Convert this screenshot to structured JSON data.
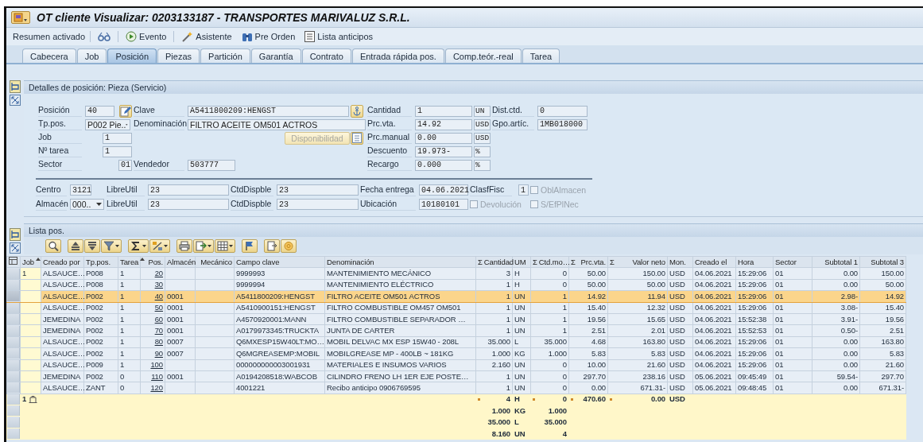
{
  "window": {
    "title": "OT cliente Visualizar: 0203133187 - TRANSPORTES MARIVALUZ S.R.L."
  },
  "toolbar": {
    "summary": "Resumen activado",
    "buttons": [
      {
        "kind": "glasses"
      },
      {
        "kind": "event",
        "label": "Evento"
      },
      {
        "kind": "wizard",
        "label": "Asistente"
      },
      {
        "kind": "binoculars",
        "label": "Pre Orden"
      },
      {
        "kind": "list",
        "label": "Lista anticipos"
      }
    ]
  },
  "tabs": [
    {
      "label": "Cabecera",
      "selected": false
    },
    {
      "label": "Job",
      "selected": false
    },
    {
      "label": "Posición",
      "selected": true
    },
    {
      "label": "Piezas",
      "selected": false
    },
    {
      "label": "Partición",
      "selected": false
    },
    {
      "label": "Garantía",
      "selected": false
    },
    {
      "label": "Contrato",
      "selected": false
    },
    {
      "label": "Entrada rápida pos.",
      "selected": false
    },
    {
      "label": "Comp.teór.-real",
      "selected": false
    },
    {
      "label": "Tarea",
      "selected": false
    }
  ],
  "details": {
    "title": "Detalles de posición: Pieza (Servicio)",
    "posicion": {
      "label": "Posición",
      "value": "40"
    },
    "tp_pos": {
      "label": "Tp.pos.",
      "value": "P002 Pie.."
    },
    "job": {
      "label": "Job",
      "value": "1"
    },
    "n_tarea": {
      "label": "Nº tarea",
      "value": "1"
    },
    "sector": {
      "label": "Sector",
      "value": "01"
    },
    "clave": {
      "label": "Clave",
      "value": "A5411800209:HENGST"
    },
    "denominacion": {
      "label": "Denominación",
      "value": "FILTRO ACEITE OM501 ACTROS"
    },
    "disponibilidad": {
      "label": "Disponibilidad",
      "disabled": true
    },
    "vendedor": {
      "label": "Vendedor",
      "value": "503777"
    },
    "cantidad": {
      "label": "Cantidad",
      "value": "1",
      "unit": "UN"
    },
    "prc_vta": {
      "label": "Prc.vta.",
      "value": "14.92",
      "unit": "USD"
    },
    "prc_manual": {
      "label": "Prc.manual",
      "value": "0.00",
      "unit": "USD"
    },
    "descuento": {
      "label": "Descuento",
      "value": "19.973-",
      "unit": "%"
    },
    "recargo": {
      "label": "Recargo",
      "value": "0.000",
      "unit": "%"
    },
    "dist_ctd": {
      "label": "Dist.ctd.",
      "value": "0"
    },
    "gpo_artic": {
      "label": "Gpo.artíc.",
      "value": "1MB018000"
    },
    "centro": {
      "label": "Centro",
      "value": "3121"
    },
    "almacen": {
      "label": "Almacén",
      "value": "000.."
    },
    "libre_util_1": {
      "label": "LibreUtil",
      "value": "23"
    },
    "libre_util_2": {
      "label": "LibreUtil",
      "value": "23"
    },
    "ctd_dispble_1": {
      "label": "CtdDispble",
      "value": "23"
    },
    "ctd_dispble_2": {
      "label": "CtdDispble",
      "value": "23"
    },
    "fecha_entrega": {
      "label": "Fecha entrega",
      "value": "04.06.2021"
    },
    "ubicacion": {
      "label": "Ubicación",
      "value": "10180101"
    },
    "clasif_fisc": {
      "label": "ClasfFisc",
      "value": "1"
    },
    "obl_almacen": {
      "label": "OblAlmacen",
      "checked": false,
      "disabled": true
    },
    "devolucion": {
      "label": "Devolución",
      "checked": false,
      "disabled": true
    },
    "s_efplnec": {
      "label": "S/EfPlNec",
      "checked": false,
      "disabled": true
    }
  },
  "list": {
    "title": "Lista pos.",
    "columns": [
      {
        "label": "Job",
        "sorted": true
      },
      {
        "label": "Creado por",
        "sorted": false
      },
      {
        "label": "Tp.pos.",
        "sorted": false
      },
      {
        "label": "Tarea",
        "sorted": true
      },
      {
        "label": "Pos.",
        "sorted": false
      },
      {
        "label": "Almacén",
        "sorted": false
      },
      {
        "label": "Mecánico",
        "sorted": false
      },
      {
        "label": "Campo clave",
        "sorted": false
      },
      {
        "label": "Denominación",
        "sorted": false
      },
      {
        "label": "Cantidad",
        "sum_mark": "Σ",
        "sorted": false
      },
      {
        "label": "UM",
        "sorted": false
      },
      {
        "label": "Ctd.mo…",
        "sum_mark": "Σ",
        "sorted": false
      },
      {
        "label": "Prc.vta.",
        "sum_mark": "Σ",
        "sorted": false
      },
      {
        "label": "Valor neto",
        "sum_mark": "Σ",
        "sorted": false
      },
      {
        "label": "Mon.",
        "sorted": false
      },
      {
        "label": "Creado el",
        "sorted": false
      },
      {
        "label": "Hora",
        "sorted": false
      },
      {
        "label": "Sector",
        "sorted": false
      },
      {
        "label": "Subtotal 1",
        "sorted": false
      },
      {
        "label": "Subtotal 3",
        "sorted": false
      }
    ],
    "rows": [
      {
        "selected": false,
        "job": "1",
        "creado_por": "ALSAUCE…",
        "tp_pos": "P008",
        "tarea": "1",
        "posicion": "20",
        "campo_clave": "9999993",
        "denominacion": "MANTENIMIENTO MECÁNICO",
        "cantidad": "3",
        "um": "H",
        "ctd_mo": "0",
        "prc_vta": "50.00",
        "valor_neto": "150.00",
        "mon": "USD",
        "creado_el": "04.06.2021",
        "hora": "15:29:06",
        "sector": "01",
        "subtotal_1": "0.00",
        "subtotal_3": "150.00"
      },
      {
        "selected": false,
        "creado_por": "ALSAUCE…",
        "tp_pos": "P008",
        "tarea": "1",
        "posicion": "30",
        "campo_clave": "9999994",
        "denominacion": "MANTENIMIENTO ELÉCTRICO",
        "cantidad": "1",
        "um": "H",
        "ctd_mo": "0",
        "prc_vta": "50.00",
        "valor_neto": "50.00",
        "mon": "USD",
        "creado_el": "04.06.2021",
        "hora": "15:29:06",
        "sector": "01",
        "subtotal_1": "0.00",
        "subtotal_3": "50.00"
      },
      {
        "selected": true,
        "creado_por": "ALSAUCE…",
        "tp_pos": "P002",
        "tarea": "1",
        "posicion": "40",
        "almacen": "0001",
        "campo_clave": "A5411800209:HENGST",
        "denominacion": "FILTRO ACEITE OM501 ACTROS",
        "cantidad": "1",
        "um": "UN",
        "ctd_mo": "1",
        "prc_vta": "14.92",
        "valor_neto": "11.94",
        "mon": "USD",
        "creado_el": "04.06.2021",
        "hora": "15:29:06",
        "sector": "01",
        "subtotal_1": "2.98-",
        "subtotal_3": "14.92"
      },
      {
        "selected": false,
        "creado_por": "ALSAUCE…",
        "tp_pos": "P002",
        "tarea": "1",
        "posicion": "50",
        "almacen": "0001",
        "campo_clave": "A5410900151:HENGST",
        "denominacion": "FILTRO COMBUSTIBLE OM457 OM501",
        "cantidad": "1",
        "um": "UN",
        "ctd_mo": "1",
        "prc_vta": "15.40",
        "valor_neto": "12.32",
        "mon": "USD",
        "creado_el": "04.06.2021",
        "hora": "15:29:06",
        "sector": "01",
        "subtotal_1": "3.08-",
        "subtotal_3": "15.40"
      },
      {
        "selected": false,
        "creado_por": "JEMEDINA",
        "tp_pos": "P002",
        "tarea": "1",
        "posicion": "60",
        "almacen": "0001",
        "campo_clave": "A4570920001:MANN",
        "denominacion": "FILTRO COMBUSTIBLE SEPARADOR …",
        "cantidad": "1",
        "um": "UN",
        "ctd_mo": "1",
        "prc_vta": "19.56",
        "valor_neto": "15.65",
        "mon": "USD",
        "creado_el": "04.06.2021",
        "hora": "15:52:38",
        "sector": "01",
        "subtotal_1": "3.91-",
        "subtotal_3": "19.56"
      },
      {
        "selected": false,
        "creado_por": "JEMEDINA",
        "tp_pos": "P002",
        "tarea": "1",
        "posicion": "70",
        "almacen": "0001",
        "campo_clave": "A0179973345:TRUCKTA",
        "denominacion": "JUNTA DE CARTER",
        "cantidad": "1",
        "um": "UN",
        "ctd_mo": "1",
        "prc_vta": "2.51",
        "valor_neto": "2.01",
        "mon": "USD",
        "creado_el": "04.06.2021",
        "hora": "15:52:53",
        "sector": "01",
        "subtotal_1": "0.50-",
        "subtotal_3": "2.51"
      },
      {
        "selected": false,
        "creado_por": "ALSAUCE…",
        "tp_pos": "P002",
        "tarea": "1",
        "posicion": "80",
        "almacen": "0007",
        "campo_clave": "Q6MXESP15W40LT:MO…",
        "denominacion": "MOBIL DELVAC MX ESP 15W40 - 208L",
        "cantidad": "35.000",
        "um": "L",
        "ctd_mo": "35.000",
        "prc_vta": "4.68",
        "valor_neto": "163.80",
        "mon": "USD",
        "creado_el": "04.06.2021",
        "hora": "15:29:06",
        "sector": "01",
        "subtotal_1": "0.00",
        "subtotal_3": "163.80"
      },
      {
        "selected": false,
        "creado_por": "ALSAUCE…",
        "tp_pos": "P002",
        "tarea": "1",
        "posicion": "90",
        "almacen": "0007",
        "campo_clave": "Q6MGREASEMP:MOBIL",
        "denominacion": "MOBILGREASE MP - 400LB ~ 181KG",
        "cantidad": "1.000",
        "um": "KG",
        "ctd_mo": "1.000",
        "prc_vta": "5.83",
        "valor_neto": "5.83",
        "mon": "USD",
        "creado_el": "04.06.2021",
        "hora": "15:29:06",
        "sector": "01",
        "subtotal_1": "0.00",
        "subtotal_3": "5.83"
      },
      {
        "selected": false,
        "creado_por": "ALSAUCE…",
        "tp_pos": "P009",
        "tarea": "1",
        "posicion": "100",
        "campo_clave": "000000000003001931",
        "denominacion": "MATERIALES E INSUMOS VARIOS",
        "cantidad": "2.160",
        "um": "UN",
        "ctd_mo": "0",
        "prc_vta": "10.00",
        "valor_neto": "21.60",
        "mon": "USD",
        "creado_el": "04.06.2021",
        "hora": "15:29:06",
        "sector": "01",
        "subtotal_1": "0.00",
        "subtotal_3": "21.60"
      },
      {
        "selected": false,
        "creado_por": "JEMEDINA",
        "tp_pos": "P002",
        "tarea": "0",
        "posicion": "110",
        "almacen": "0001",
        "campo_clave": "A0194208518:WABCOB",
        "denominacion": "CILINDRO FRENO LH 1ER EJE POSTE…",
        "cantidad": "1",
        "um": "UN",
        "ctd_mo": "0",
        "prc_vta": "297.70",
        "valor_neto": "238.16",
        "mon": "USD",
        "creado_el": "05.06.2021",
        "hora": "09:45:49",
        "sector": "01",
        "subtotal_1": "59.54-",
        "subtotal_3": "297.70"
      },
      {
        "selected": false,
        "creado_por": "ALSAUCE…",
        "tp_pos": "ZANT",
        "tarea": "0",
        "posicion": "120",
        "campo_clave": "4001221",
        "denominacion": "Recibo anticipo 0906769595",
        "cantidad": "1",
        "um": "UN",
        "ctd_mo": "0",
        "prc_vta": "0.00",
        "valor_neto": "671.31-",
        "mon": "USD",
        "creado_el": "05.06.2021",
        "hora": "09:48:45",
        "sector": "01",
        "subtotal_1": "0.00",
        "subtotal_3": "671.31-"
      }
    ],
    "totals": [
      {
        "job": "1",
        "marked": true,
        "cantidad": "4",
        "um": "H",
        "ctd_mo": "0",
        "prc_vta": "470.60",
        "valor_neto": "0.00",
        "mon": "USD"
      },
      {
        "marked": false,
        "cantidad": "1.000",
        "um": "KG",
        "ctd_mo": "1.000"
      },
      {
        "marked": false,
        "cantidad": "35.000",
        "um": "L",
        "ctd_mo": "35.000"
      },
      {
        "marked": false,
        "cantidad": "8.160",
        "um": "UN",
        "ctd_mo": "4"
      }
    ]
  }
}
